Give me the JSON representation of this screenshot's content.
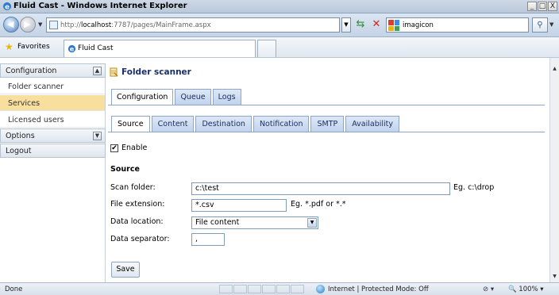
{
  "window": {
    "title": "Fluid Cast - Windows Internet Explorer",
    "min": "_",
    "max": "□",
    "close": "X"
  },
  "address": {
    "url_prefix": "http://",
    "url_host": "localhost",
    "url_rest": ":7787/pages/MainFrame.aspx",
    "search_value": "imagicon"
  },
  "favorites": {
    "label": "Favorites",
    "tab_label": "Fluid Cast"
  },
  "sidebar": {
    "configuration_header": "Configuration",
    "items": [
      {
        "label": "Folder scanner",
        "selected": false
      },
      {
        "label": "Services",
        "selected": true
      },
      {
        "label": "Licensed users",
        "selected": false
      }
    ],
    "options_header": "Options",
    "logout": "Logout"
  },
  "page": {
    "title": "Folder scanner"
  },
  "tabs_top": [
    {
      "label": "Configuration",
      "active": true
    },
    {
      "label": "Queue",
      "active": false
    },
    {
      "label": "Logs",
      "active": false
    }
  ],
  "tabs_sub": [
    {
      "label": "Source",
      "active": true
    },
    {
      "label": "Content",
      "active": false
    },
    {
      "label": "Destination",
      "active": false
    },
    {
      "label": "Notification",
      "active": false
    },
    {
      "label": "SMTP",
      "active": false
    },
    {
      "label": "Availability",
      "active": false
    }
  ],
  "form": {
    "enable_label": "Enable",
    "enable_checked": true,
    "section_title": "Source",
    "scan_folder_label": "Scan folder:",
    "scan_folder_value": "c:\\test",
    "scan_folder_hint": "Eg. c:\\drop",
    "file_extension_label": "File extension:",
    "file_extension_value": "*.csv",
    "file_extension_hint": "Eg. *.pdf or *.*",
    "data_location_label": "Data location:",
    "data_location_value": "File content",
    "data_separator_label": "Data separator:",
    "data_separator_value": ",",
    "save_label": "Save"
  },
  "status": {
    "text": "Done",
    "zone": "Internet | Protected Mode: Off",
    "zoom": "100%"
  }
}
